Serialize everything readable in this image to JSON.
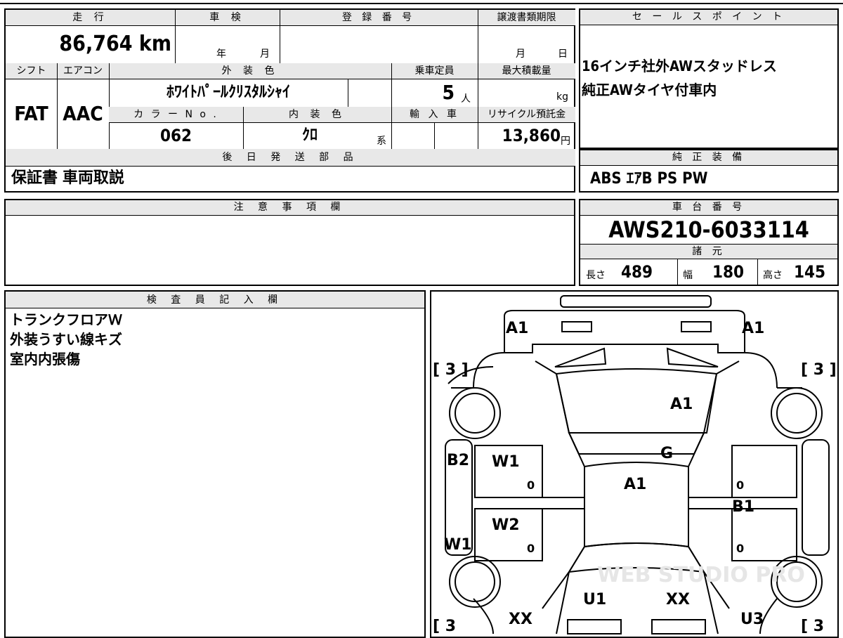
{
  "top_info": {
    "distance_label": "走 行",
    "distance_value": "86,764 km",
    "inspection_label": "車 検",
    "inspection_year_unit": "年",
    "inspection_month_unit": "月",
    "registration_label": "登 録 番 号",
    "transfer_deadline_label": "譲渡書類期限",
    "transfer_month_unit": "月",
    "transfer_day_unit": "日"
  },
  "specs": {
    "shift_label": "シフト",
    "shift_value": "FAT",
    "aircon_label": "エアコン",
    "aircon_value": "AAC",
    "exterior_color_label": "外 装 色",
    "exterior_color_value": "ﾎﾜｲﾄﾊﾟｰﾙｸﾘｽﾀﾙｼｬｲ",
    "capacity_label": "乗車定員",
    "capacity_value": "5",
    "capacity_unit": "人",
    "max_load_label": "最大積載量",
    "max_load_unit": "kg",
    "color_no_label": "カ ラ ー N o .",
    "color_no_value": "062",
    "interior_color_label": "内 装 色",
    "interior_color_value": "ｸﾛ",
    "interior_color_suffix": "系",
    "import_label": "輸 入 車",
    "recycle_label": "リサイクル預託金",
    "recycle_value": "13,860",
    "recycle_unit": "円"
  },
  "later_parts": {
    "label": "後 日 発 送 部 品",
    "value": "保証書 車両取説"
  },
  "notes": {
    "label": "注 意 事 項 欄",
    "value": ""
  },
  "sales_points": {
    "label": "セ ー ル ス ポ イ ン ト",
    "lines": [
      "16インチ社外AWスタッドレス",
      "純正AWタイヤ付車内"
    ]
  },
  "standard_equipment": {
    "label": "純 正 装 備",
    "value": "ABS ｴｱB PS PW"
  },
  "chassis": {
    "label": "車 台 番 号",
    "value": "AWS210-6033114"
  },
  "dimensions": {
    "label": "諸 元",
    "length_label": "長さ",
    "length_value": "489",
    "width_label": "幅",
    "width_value": "180",
    "height_label": "高さ",
    "height_value": "145"
  },
  "inspector": {
    "label": "検 査 員 記 入 欄",
    "lines": [
      "トランクフロアＷ",
      "外装うすい線キズ",
      "室内内張傷"
    ]
  },
  "diagram": {
    "tire_left_top": "[ 3 ]",
    "tire_right_top": "[ 3 ]",
    "tire_left_bottom": "[ 3",
    "tire_right_bottom": "[ 3",
    "rear_left": "A1",
    "rear_right": "A1",
    "trunk": "A1",
    "rear_glass": "G",
    "roof": "A1",
    "left_rear_quarter": "B2",
    "left_rear_door": "W1",
    "left_front_door": "W2",
    "left_front_fender": "W1",
    "right_side": "B1",
    "hood_left": "U1",
    "hood_right": "XX",
    "front_left": "XX",
    "front_right": "U3",
    "zero_mark": "0",
    "watermark": "WEB STUDIO PRO"
  }
}
